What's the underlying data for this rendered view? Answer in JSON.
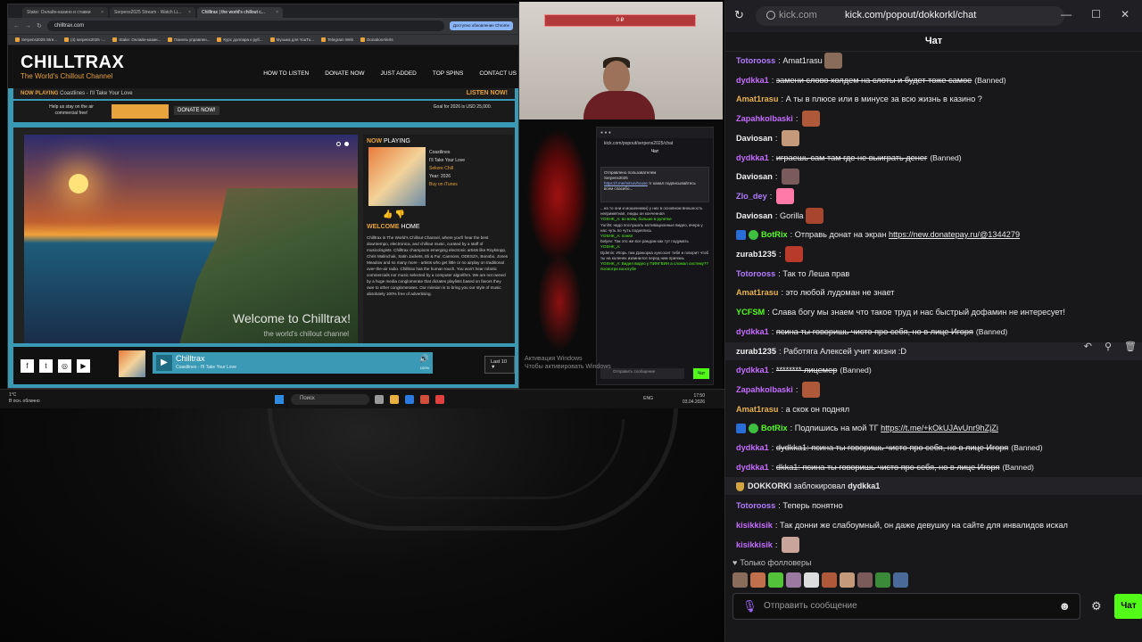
{
  "colors": {
    "kick_green": "#53fc18",
    "chilltrax_orange": "#e8a33d",
    "chilltrax_teal": "#3a9ab5"
  },
  "capture": {
    "tabs": [
      "Stake: Онлайн-казино и ставки",
      "Serpens2025 Stream - Watch Li...",
      "Chilltrax | the world's chillout c..."
    ],
    "url": "chilltrax.com",
    "update_notice": "Доступно обновление Chrome",
    "bookmarks": [
      "Serpens2025 Stre...",
      "(4) serpens2025 -...",
      "Stake: Онлайн-казин...",
      "Панель управлен...",
      "Курс доллара к руб...",
      "Музыка для YouTu...",
      "Telegram Web",
      "DonationAlerts"
    ],
    "site": {
      "logo": "CHILLTRAX",
      "tagline": "The World's Chillout Channel",
      "nav": [
        "HOW TO LISTEN",
        "DONATE NOW",
        "JUST ADDED",
        "TOP SPINS",
        "CONTACT US"
      ],
      "now_playing_label": "NOW PLAYING",
      "now_playing_track": "Coastlines - I'll Take Your Love",
      "listen_now": "LISTEN NOW!",
      "help_text": "Help us stay on the air commercial free!",
      "donate_button": "DONATE NOW!",
      "goal": "Goal for 2026 is USD 25,000.",
      "hero_welcome": "Welcome to Chilltrax!",
      "hero_sub": "the world's chillout channel",
      "side_now": "NOW",
      "side_playing": " PLAYING",
      "meta": [
        "Coastlines",
        "I'll Take Your Love",
        "Sekore Chill",
        "Year: 2026",
        "Buy on iTunes"
      ],
      "welcome_a": "WELCOME",
      "welcome_b": " HOME",
      "body": "Chilltrax is The World's Chillout Channel, where you'll hear the best downtempo, electronica, and chillout music, curated by a staff of musicologists. Chilltrax champions emerging electronic artists like Royksopp, Chris Malinchak, Satin Jackets, Eli & Fur, Cannons, ODESZA, Bonobo, Jones Meadow and so many more - artists who get little or no airplay on traditional over-the-air radio. Chilltrax has the human touch. You won't hear robotic commercials nor music selected by a computer algorithm. We are not owned by a huge media conglomerate that dictates playlists based on favors they owe to other conglomerates. Our mission is to bring you our style of music absolutely 100% free of advertising.",
      "player_title": "Chilltrax",
      "player_track": "Coastlines - I'll Take Your Love",
      "volume": "100%",
      "last_button": "Last 10 ▼",
      "social_icons": [
        "facebook-icon",
        "twitter-icon",
        "instagram-icon",
        "youtube-icon"
      ]
    },
    "taskbar": {
      "weather": "1°C",
      "weather_sub": "В осн. облачно",
      "search": "Поиск",
      "lang": "ENG",
      "time": "17:50",
      "date": "03.04.2026"
    },
    "windows_activation_1": "Активация Windows",
    "windows_activation_2": "Чтобы активировать Windows"
  },
  "webcam": {
    "bar_value": "0 ₽"
  },
  "mini_chat": {
    "url": "kick.com/popout/serpens2025/chat",
    "title": "Чат",
    "popup_title": "Отправлено пользователем",
    "popup_user": "Serpens2025",
    "popup_link": "https://t.me/mitsovhouse",
    "popup_text": "тг канал подписывайтесь всем спасибо...",
    "lines": [
      "...на то они и мошенники) у них в основном внешность неприметная, гниды он конченная",
      "YOSHK_A: во всём, больше в рулетке",
      "YuriiN: надо послушать мотивационные видео, вчера у нас чуть по чуть поднялись",
      "YOSHK_A: понял",
      "belyev: Так это же все рандом как тут подумать",
      "YOSHK_A:",
      "Djdenis: Игорь там Доккорка хуесосит тебя и говорит чтоб ты на коленях извинился перед ним прияэнь",
      "YOSHK_A: Видел видео у ПИНГВИН а сломал систему?? посмотри на ютубе"
    ],
    "input_placeholder": "Отправить сообщение",
    "send": "Чат"
  },
  "chat": {
    "domain": "kick.com",
    "path": "kick.com/popout/dokkorkl/chat",
    "title": "Чат",
    "messages": [
      {
        "user": "Totorooss",
        "color": "#b37bff",
        "text": "Amat1rasu",
        "emote": "#8a6c5a"
      },
      {
        "user": "dydkka1",
        "color": "#c56cff",
        "text": "замени слово холдем на слоты и будет тоже самое",
        "strike": true,
        "banned": "(Banned)"
      },
      {
        "user": "Amat1rasu",
        "color": "#e8b14a",
        "text": "А ты в плюсе или в минусе за всю жизнь в казино ?"
      },
      {
        "user": "Zapahkolbaski",
        "color": "#c56cff",
        "text": "",
        "emote": "#b0593a"
      },
      {
        "user": "Daviosan",
        "color": "#f2f2f2",
        "text": "",
        "emote": "#c49a7a"
      },
      {
        "user": "dydkka1",
        "color": "#c56cff",
        "text": "играешь сам там где не выиграть денег",
        "strike": true,
        "banned": "(Banned)"
      },
      {
        "user": "Daviosan",
        "color": "#f2f2f2",
        "text": "",
        "emote": "#7a5a5a"
      },
      {
        "user": "Zlo_dey",
        "color": "#b37bff",
        "text": "",
        "emote": "#ff7aa8"
      },
      {
        "user": "Daviosan",
        "color": "#f2f2f2",
        "text": "Gorilla",
        "emote": "#a8452e"
      },
      {
        "user": "BotRix",
        "color": "#53fc18",
        "text": "Отправь донат на экран",
        "link": "https://new.donatepay.ru/@1344279",
        "badges": true
      },
      {
        "user": "zurab1235",
        "color": "#f2f2f2",
        "text": "",
        "emote": "#b83a2a"
      },
      {
        "user": "Totorooss",
        "color": "#b37bff",
        "text": "Так то Леша прав"
      },
      {
        "user": "Amat1rasu",
        "color": "#e8b14a",
        "text": "это любой лудоман не знает"
      },
      {
        "user": "YCFSM",
        "color": "#53fc18",
        "text": "Слава богу мы знаем что такое труд и нас быстрый дофамин не интересует!"
      },
      {
        "user": "dydkka1",
        "color": "#c56cff",
        "text": "псина ты говоришь чисто про себя, но в лице Игоря",
        "strike": true,
        "banned": "(Banned)"
      },
      {
        "user": "zurab1235",
        "color": "#f2f2f2",
        "text": "Работяга Алексей учит жизни :D",
        "highlight": true
      },
      {
        "user": "dydkka1",
        "color": "#c56cff",
        "text": "******** лицемер",
        "strike": true,
        "banned": "(Banned)"
      },
      {
        "user": "Zapahkolbaski",
        "color": "#c56cff",
        "text": "",
        "emote": "#b0593a"
      },
      {
        "user": "Amat1rasu",
        "color": "#e8b14a",
        "text": "а скок он поднял"
      },
      {
        "user": "BotRix",
        "color": "#53fc18",
        "text": "Подпишись на мой ТГ",
        "link": "https://t.me/+kOkUJAvUnr9hZjZi",
        "badges": true
      },
      {
        "user": "dydkka1",
        "color": "#c56cff",
        "text": "dydkka1: псина ты говоришь чисто про себя, но в лице Игоря",
        "strike": true,
        "banned": "(Banned)"
      },
      {
        "user": "dydkka1",
        "color": "#c56cff",
        "text": "dkka1: псина ты говоришь чисто про себя, но в лице Игоря",
        "strike": true,
        "banned": "(Banned)"
      },
      {
        "system": true,
        "actor": "DOKKORKI",
        "action": "заблокировал",
        "target": "dydkka1"
      },
      {
        "user": "Totorooss",
        "color": "#b37bff",
        "text": "Теперь понятно"
      },
      {
        "user": "kisikkisik",
        "color": "#c56cff",
        "text": "Так донни же слабоумный, он даже девушку на сайте для инвалидов искал"
      },
      {
        "user": "kisikkisik",
        "color": "#c56cff",
        "text": "",
        "emote": "#c9a49a"
      }
    ],
    "followers_only": "Только фолловеры",
    "emote_colors": [
      "#8a6c5a",
      "#c0704a",
      "#53c43a",
      "#9a7aa0",
      "#dddddd",
      "#b0593a",
      "#c49a7a",
      "#7a5a5a",
      "#3a8a3a",
      "#4a6a9a"
    ],
    "input_placeholder": "Отправить сообщение",
    "send_label": "Чат"
  }
}
